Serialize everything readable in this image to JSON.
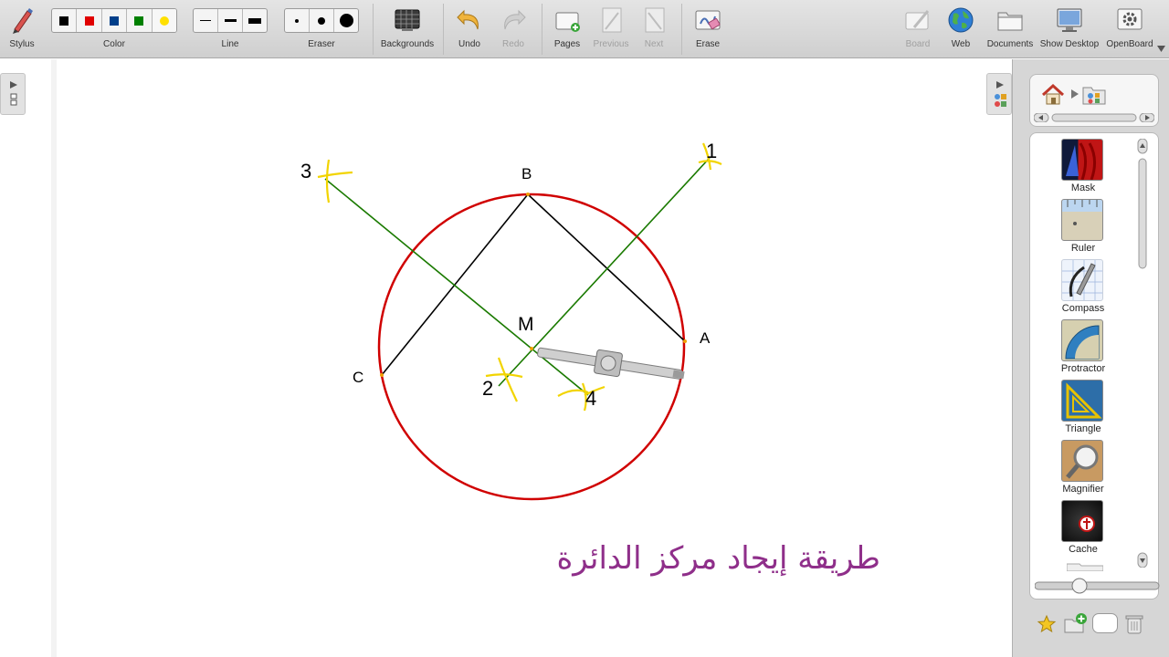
{
  "toolbar": {
    "stylus": "Stylus",
    "color": "Color",
    "colors": [
      "#000000",
      "#e00000",
      "#003f8a",
      "#008000",
      "#ffe000"
    ],
    "line": "Line",
    "eraser": "Eraser",
    "backgrounds": "Backgrounds",
    "undo": "Undo",
    "redo": "Redo",
    "pages": "Pages",
    "previous": "Previous",
    "next": "Next",
    "erase": "Erase",
    "board": "Board",
    "web": "Web",
    "documents": "Documents",
    "show_desktop": "Show Desktop",
    "openboard": "OpenBoard"
  },
  "board": {
    "labels": {
      "point_b": "B",
      "point_a": "A",
      "point_c": "C",
      "point_m": "M",
      "mark_1": "1",
      "mark_2": "2",
      "mark_3": "3",
      "mark_4": "4"
    },
    "title": "طريقة إيجاد مركز الدائرة",
    "colors": {
      "circle": "#d00000",
      "chords": "#000000",
      "bisectors": "#1a7a00",
      "arc_marks": "#f2d400",
      "title": "#8f2f8a"
    }
  },
  "library": {
    "items": [
      "Mask",
      "Ruler",
      "Compass",
      "Protractor",
      "Triangle",
      "Magnifier",
      "Cache"
    ]
  }
}
